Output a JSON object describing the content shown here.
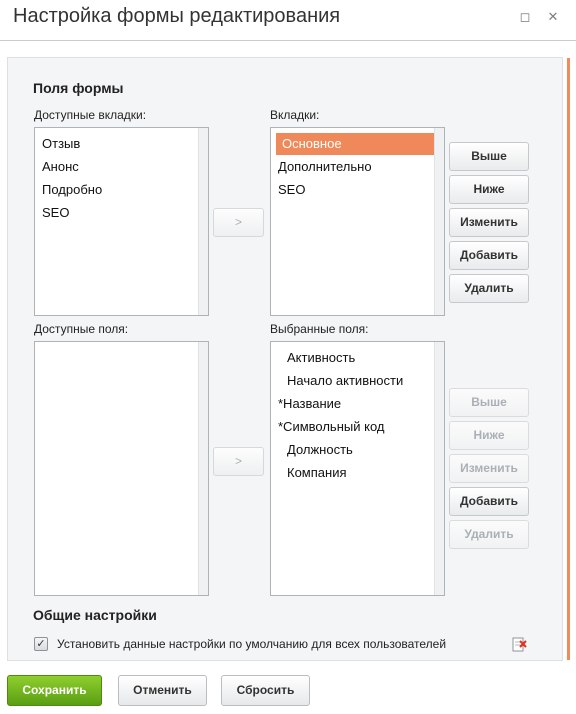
{
  "window": {
    "title": "Настройка формы редактирования",
    "minimize_glyph": "◻",
    "close_glyph": "✕"
  },
  "form_fields": {
    "title": "Поля формы",
    "available_tabs_label": "Доступные вкладки:",
    "available_tabs": [
      "Отзыв",
      "Анонс",
      "Подробно",
      "SEO"
    ],
    "tabs_label": "Вкладки:",
    "tabs": [
      "Основное",
      "Дополнительно",
      "SEO"
    ],
    "selected_tab": "Основное",
    "available_fields_label": "Доступные поля:",
    "available_fields": [],
    "selected_fields_label": "Выбранные поля:",
    "selected_fields": [
      "Активность",
      "Начало активности",
      "*Название",
      "*Символьный код",
      "Должность",
      "Компания"
    ],
    "move_button": ">",
    "tab_buttons": {
      "up": "Выше",
      "down": "Ниже",
      "edit": "Изменить",
      "add": "Добавить",
      "delete": "Удалить"
    },
    "field_buttons": {
      "up": "Выше",
      "down": "Ниже",
      "edit": "Изменить",
      "add": "Добавить",
      "delete": "Удалить"
    }
  },
  "general_settings": {
    "title": "Общие настройки",
    "default_for_all_label": "Установить данные настройки по умолчанию для всех пользователей",
    "default_for_all_checked": true,
    "reset_icon": "delete-settings-icon"
  },
  "footer": {
    "save": "Сохранить",
    "cancel": "Отменить",
    "reset": "Сбросить"
  },
  "colors": {
    "accent": "#f0895a",
    "primary_button": "#6fb21e"
  }
}
